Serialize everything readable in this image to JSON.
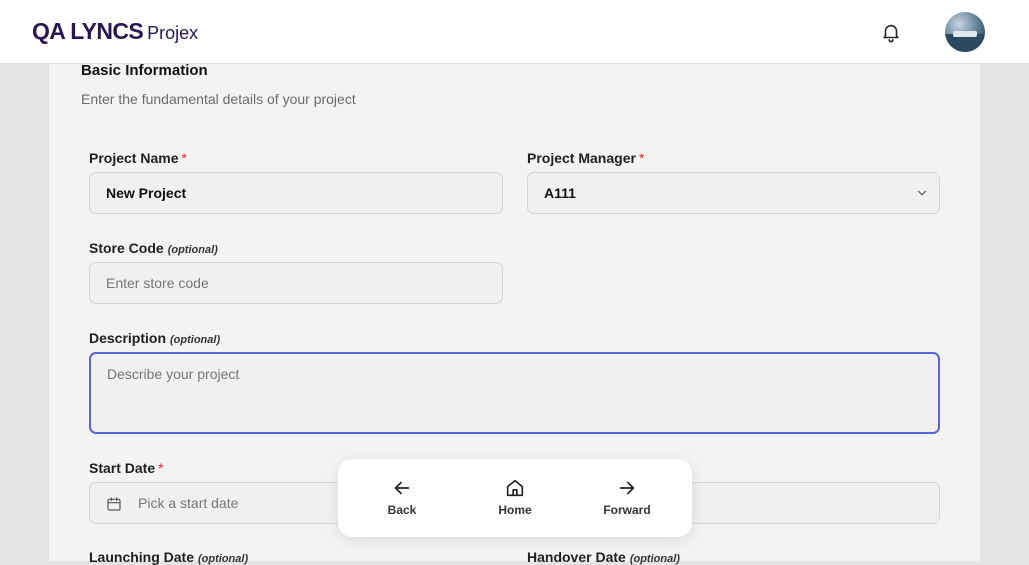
{
  "header": {
    "brand_main": "QA LYNCS",
    "brand_sub": "Projex",
    "notifications_icon": "bell-icon",
    "avatar_icon": "user-avatar"
  },
  "form": {
    "section_title": "Basic Information",
    "section_subtitle": "Enter the fundamental details of your project",
    "required_mark": "*",
    "project_name": {
      "label": "Project Name",
      "value": "New Project"
    },
    "project_manager": {
      "label": "Project Manager",
      "value": "A111"
    },
    "store_code": {
      "label": "Store Code",
      "optional": "(optional)",
      "placeholder": "Enter store code"
    },
    "description": {
      "label": "Description",
      "optional": "(optional)",
      "placeholder": "Describe your project"
    },
    "start_date": {
      "label": "Start Date",
      "placeholder": "Pick a start date"
    },
    "launching_date": {
      "label": "Launching Date",
      "optional": "(optional)"
    },
    "handover_date": {
      "label": "Handover Date",
      "optional": "(optional)"
    }
  },
  "nav_popup": {
    "back": "Back",
    "home": "Home",
    "forward": "Forward"
  },
  "colors": {
    "brand": "#2a1654",
    "required": "#e02424",
    "focus_border": "#5566d6"
  }
}
